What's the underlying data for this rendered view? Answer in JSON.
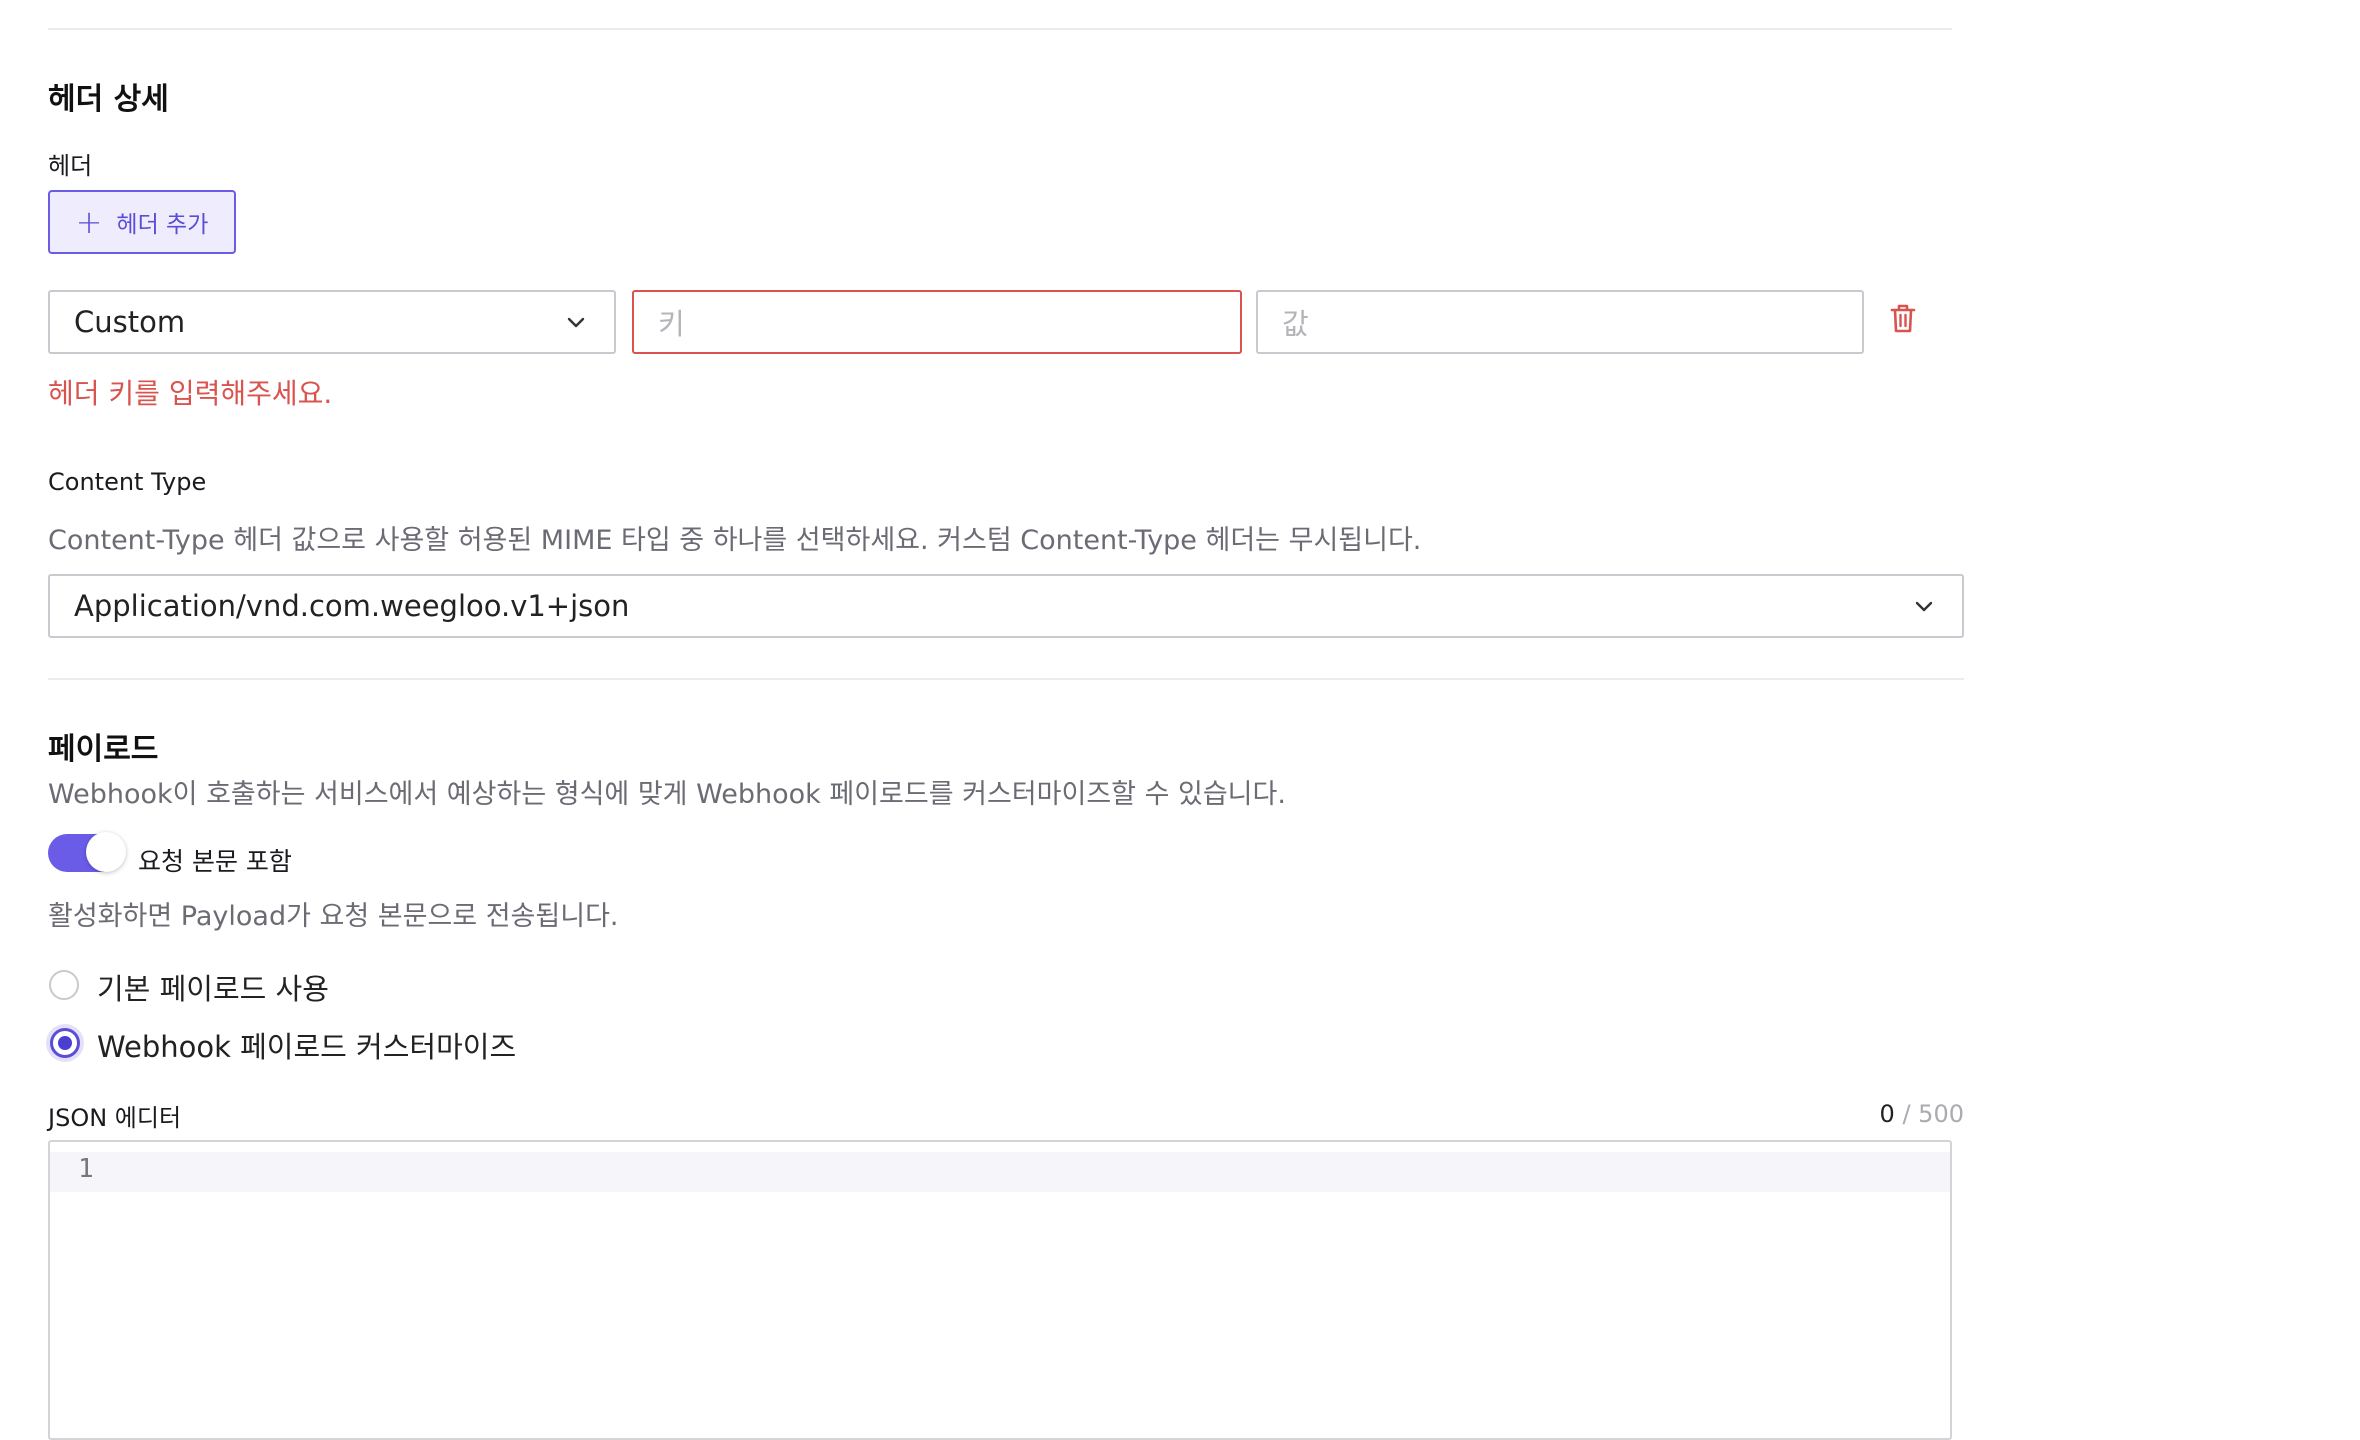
{
  "header_section": {
    "title": "헤더 상세",
    "header_label": "헤더",
    "add_button_label": "헤더 추가",
    "row": {
      "type_value": "Custom",
      "key_placeholder": "키",
      "value_placeholder": "값"
    },
    "key_error": "헤더 키를 입력해주세요."
  },
  "content_type": {
    "label": "Content Type",
    "description": "Content-Type 헤더 값으로 사용할 허용된 MIME 타입 중 하나를 선택하세요. 커스텀 Content-Type 헤더는 무시됩니다.",
    "selected": "Application/vnd.com.weegloo.v1+json"
  },
  "payload": {
    "title": "페이로드",
    "description": "Webhook이 호출하는 서비스에서 예상하는 형식에 맞게 Webhook 페이로드를 커스터마이즈할 수 있습니다.",
    "toggle_label": "요청 본문 포함",
    "toggle_on": true,
    "toggle_help": "활성화하면 Payload가 요청 본문으로 전송됩니다.",
    "options": [
      {
        "label": "기본 페이로드 사용",
        "selected": false
      },
      {
        "label": "Webhook 페이로드 커스터마이즈",
        "selected": true
      }
    ],
    "editor_label": "JSON 에디터",
    "char_count": "0",
    "char_max": "/ 500",
    "line_number": "1"
  },
  "colors": {
    "accent": "#6b5ce7",
    "error": "#d9534f"
  },
  "icons": {
    "add": "plus-icon",
    "dropdown": "chevron-down-icon",
    "delete": "trash-icon"
  }
}
